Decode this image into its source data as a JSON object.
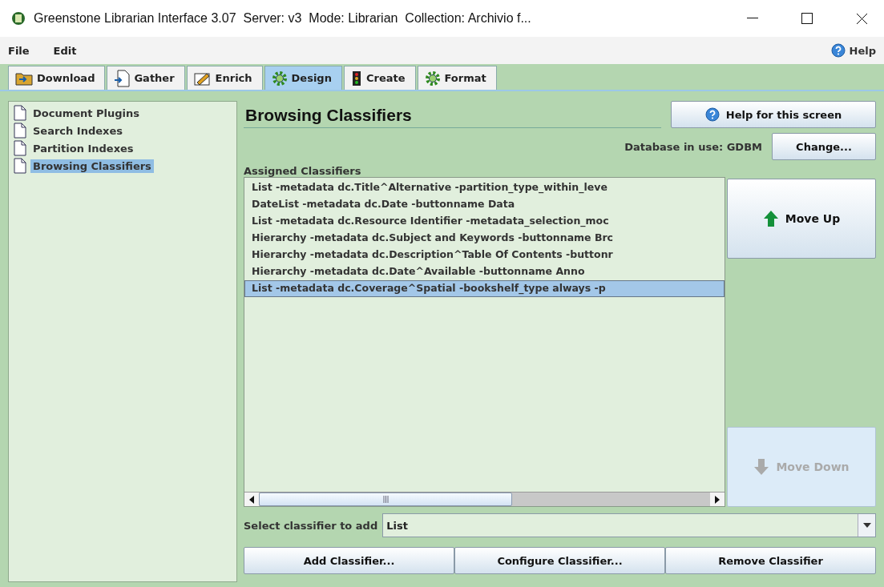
{
  "window": {
    "title": "Greenstone Librarian Interface 3.07  Server: v3  Mode: Librarian  Collection: Archivio f..."
  },
  "menu": [
    "File",
    "Edit"
  ],
  "help_link": "Help",
  "tabs": [
    {
      "label": "Download",
      "kind": "download",
      "selected": false
    },
    {
      "label": "Gather",
      "kind": "gather",
      "selected": false
    },
    {
      "label": "Enrich",
      "kind": "enrich",
      "selected": false
    },
    {
      "label": "Design",
      "kind": "gear",
      "selected": true
    },
    {
      "label": "Create",
      "kind": "lights",
      "selected": false
    },
    {
      "label": "Format",
      "kind": "gear",
      "selected": false
    }
  ],
  "sidebar": {
    "items": [
      {
        "label": "Document Plugins",
        "selected": false
      },
      {
        "label": "Search Indexes",
        "selected": false
      },
      {
        "label": "Partition Indexes",
        "selected": false
      },
      {
        "label": "Browsing Classifiers",
        "selected": true
      }
    ]
  },
  "panel": {
    "title": "Browsing Classifiers",
    "help_button": "Help for this screen",
    "database_label": "Database in use: GDBM",
    "change_button": "Change...",
    "list_label": "Assigned Classifiers",
    "classifiers": [
      {
        "text": "List -metadata dc.Title^Alternative -partition_type_within_leve",
        "selected": false
      },
      {
        "text": "DateList -metadata dc.Date -buttonname Data",
        "selected": false
      },
      {
        "text": "List -metadata dc.Resource Identifier -metadata_selection_moc",
        "selected": false
      },
      {
        "text": "Hierarchy -metadata dc.Subject and Keywords -buttonname Brc",
        "selected": false
      },
      {
        "text": "Hierarchy -metadata dc.Description^Table Of Contents -buttonr",
        "selected": false
      },
      {
        "text": "Hierarchy -metadata dc.Date^Available -buttonname Anno",
        "selected": false
      },
      {
        "text": "List -metadata dc.Coverage^Spatial -bookshelf_type always -p",
        "selected": true
      }
    ],
    "move_buttons": [
      {
        "label": "Move Up",
        "kind": "up",
        "disabled": false
      },
      {
        "label": "Move Down",
        "kind": "down",
        "disabled": true
      }
    ],
    "select_label": "Select classifier to add",
    "select_value": "List",
    "actions": [
      "Add Classifier...",
      "Configure Classifier...",
      "Remove Classifier"
    ]
  }
}
